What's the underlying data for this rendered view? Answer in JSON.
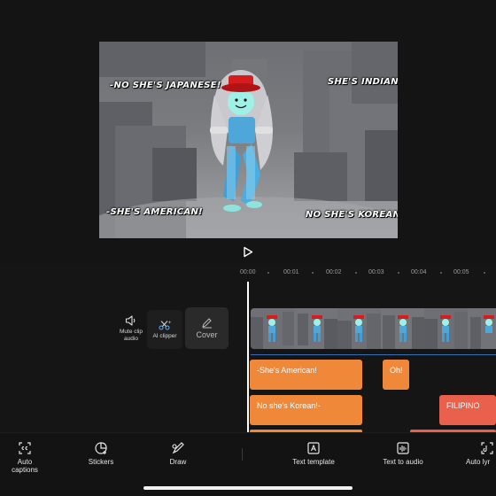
{
  "preview": {
    "captions": {
      "top_left": "-No she's Japanese!",
      "top_right": "She's Indian!-",
      "bottom_left": "-She's American!",
      "bottom_right": "No she's Korean!-"
    },
    "play_icon": "play-icon"
  },
  "timeline": {
    "ruler": [
      "00:00",
      "00:01",
      "00:02",
      "00:03",
      "00:04",
      "00:05"
    ],
    "side_tools": {
      "mute_clip_audio": "Mute clip audio",
      "ai_clipper": "AI clipper",
      "cover": "Cover"
    },
    "text_tracks": [
      {
        "label": "-She's American!",
        "color": "#f0883a"
      },
      {
        "label": "Oh!",
        "color": "#f0883a"
      },
      {
        "label": "No she's Korean!-",
        "color": "#f0883a"
      },
      {
        "label": "FILIPINO",
        "color": "#e9604c"
      }
    ]
  },
  "toolbar": {
    "items": [
      {
        "label": "Auto captions",
        "icon": "auto-captions-icon"
      },
      {
        "label": "Stickers",
        "icon": "stickers-icon"
      },
      {
        "label": "Draw",
        "icon": "draw-icon"
      },
      {
        "label": "Text template",
        "icon": "text-template-icon"
      },
      {
        "label": "Text to audio",
        "icon": "text-to-audio-icon"
      },
      {
        "label": "Auto lyr",
        "icon": "auto-lyrics-icon"
      }
    ]
  },
  "colors": {
    "background": "#141414",
    "text_track": "#f0883a",
    "text_track_alt": "#e9604c",
    "playhead": "#ffffff"
  }
}
